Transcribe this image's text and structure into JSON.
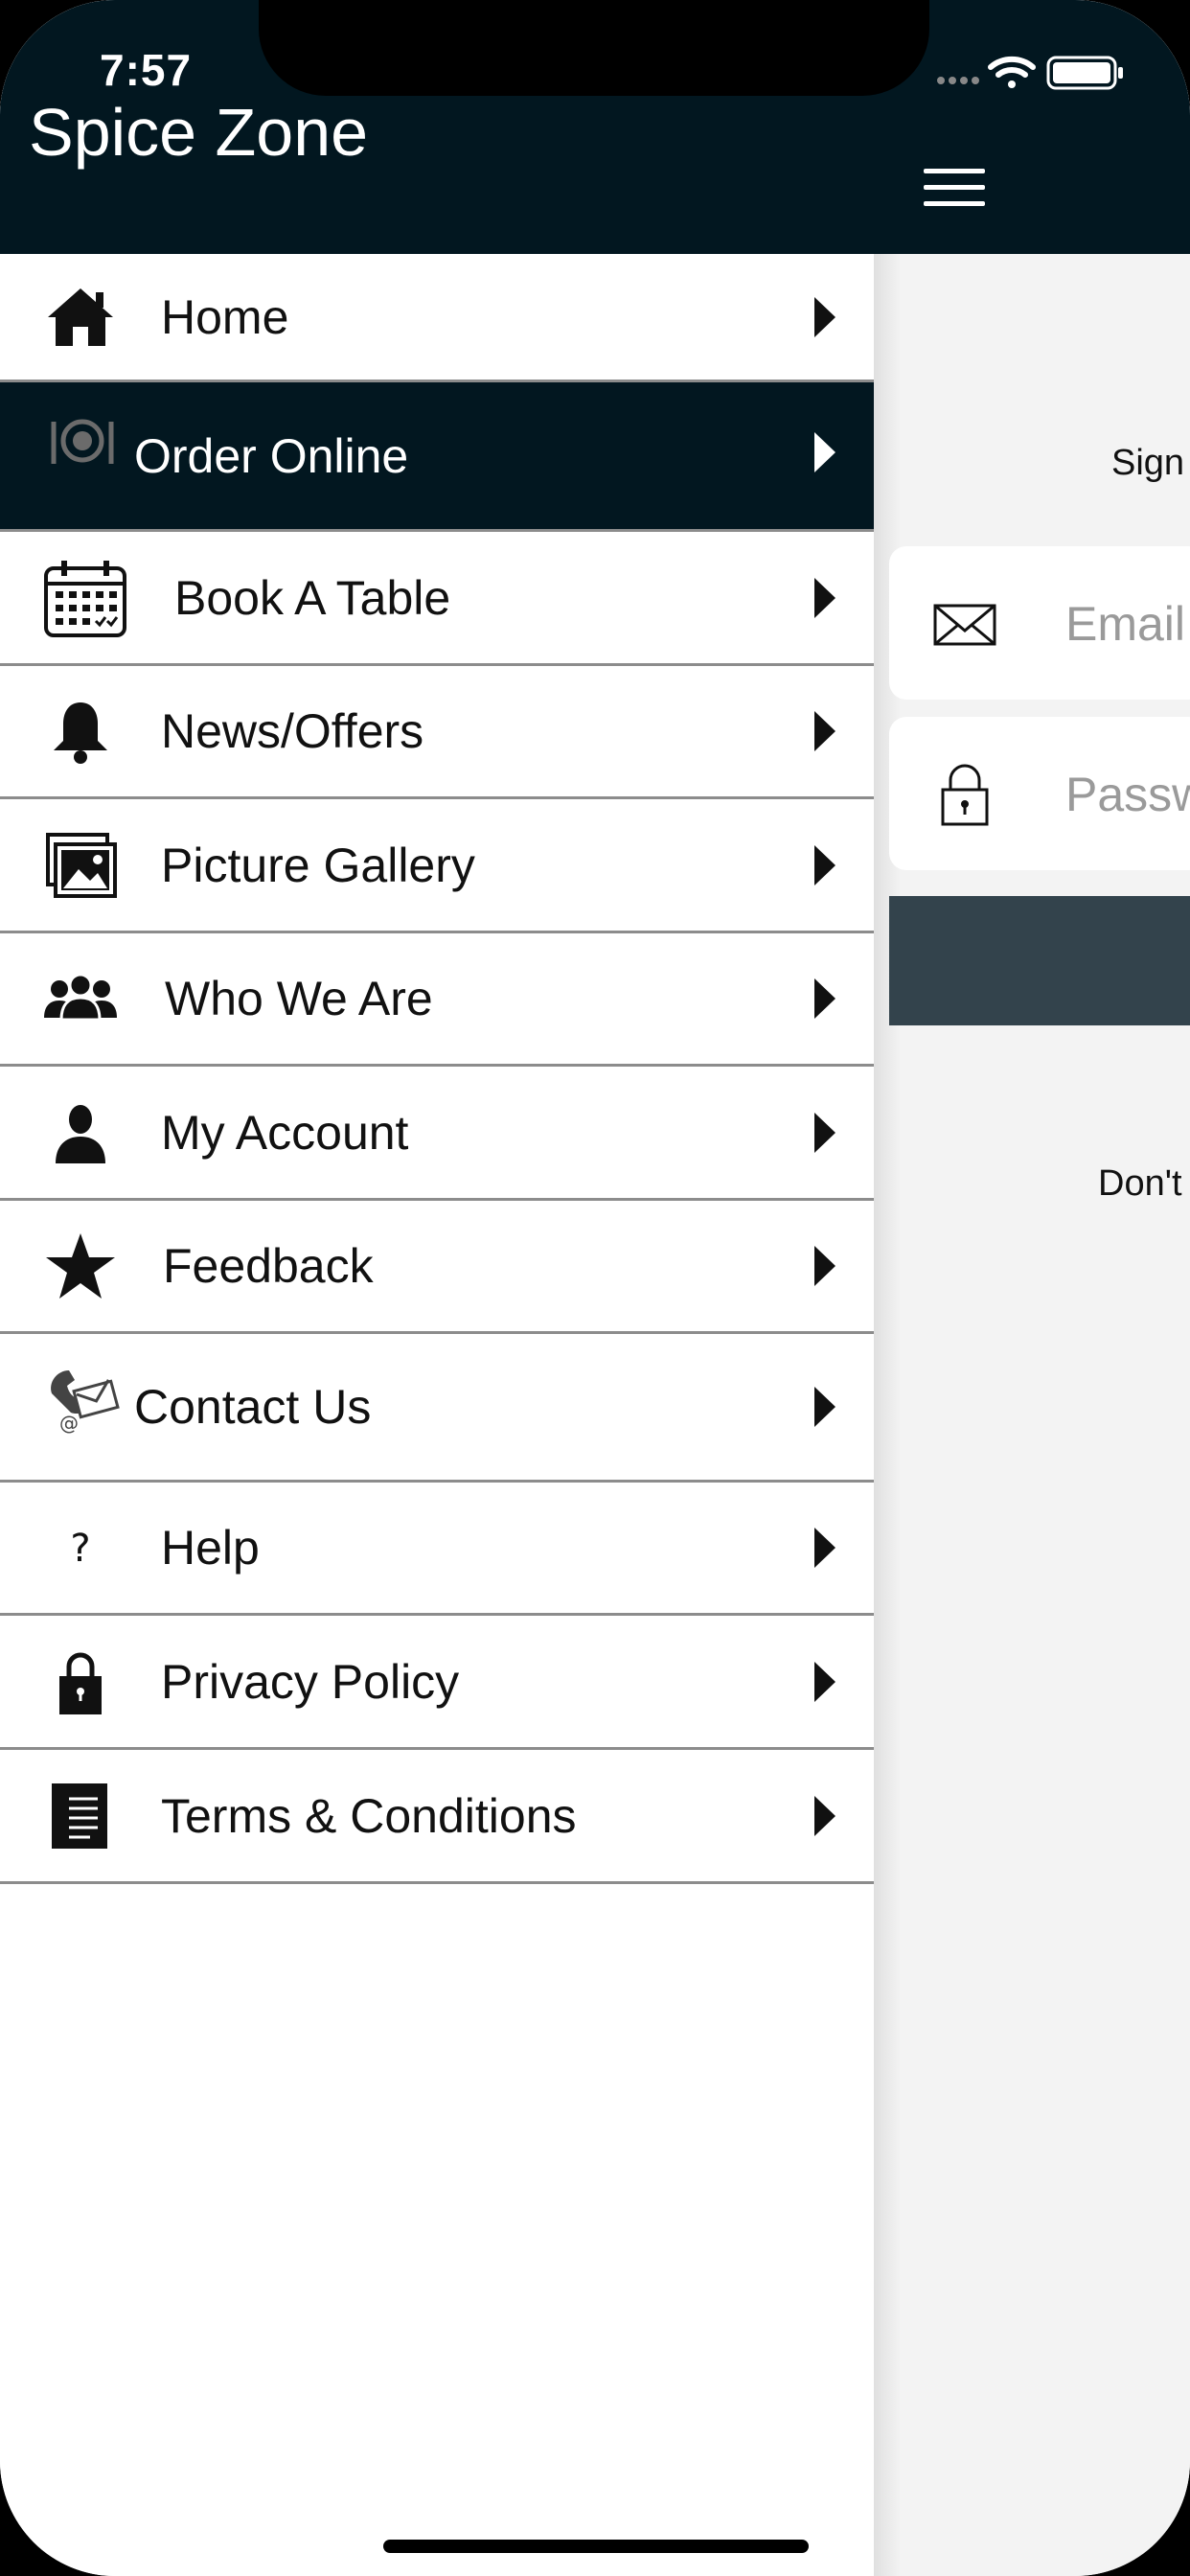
{
  "status_bar": {
    "time": "7:57"
  },
  "app": {
    "title": "Spice Zone"
  },
  "login_panel": {
    "sign_in_text": "Sign",
    "email_placeholder": "Email",
    "password_placeholder": "Passw",
    "signup_prompt": "Don't"
  },
  "menu": {
    "items": [
      {
        "label": "Home",
        "icon": "home-icon"
      },
      {
        "label": "Order Online",
        "icon": "plate-cutlery-icon",
        "active": true
      },
      {
        "label": "Book A Table",
        "icon": "calendar-icon"
      },
      {
        "label": "News/Offers",
        "icon": "bell-icon"
      },
      {
        "label": "Picture Gallery",
        "icon": "gallery-icon"
      },
      {
        "label": "Who We Are",
        "icon": "group-icon"
      },
      {
        "label": "My Account",
        "icon": "user-icon"
      },
      {
        "label": "Feedback",
        "icon": "star-icon"
      },
      {
        "label": "Contact Us",
        "icon": "phone-mail-icon"
      },
      {
        "label": "Help",
        "icon": "question-icon"
      },
      {
        "label": "Privacy Policy",
        "icon": "lock-icon"
      },
      {
        "label": "Terms & Conditions",
        "icon": "document-icon"
      }
    ]
  },
  "colors": {
    "header_bg": "#021720",
    "active_item_bg": "#021720",
    "submit_button_bg": "#33434c",
    "content_bg": "#f3f3f3"
  }
}
